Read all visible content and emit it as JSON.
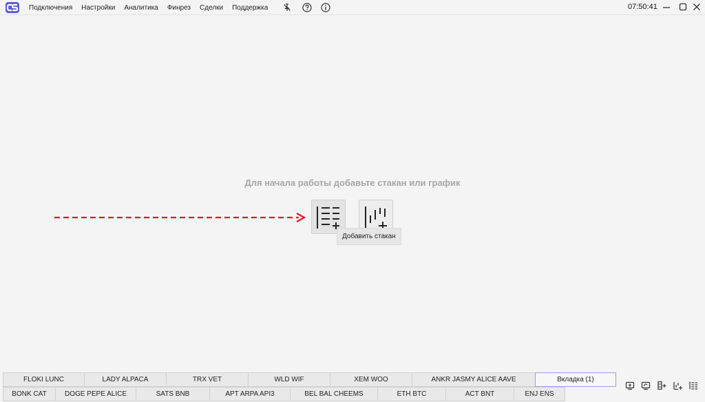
{
  "menu": {
    "items": [
      "Подключения",
      "Настройки",
      "Аналитика",
      "Финрез",
      "Сделки",
      "Поддержка"
    ]
  },
  "header": {
    "icons": [
      "pin-off-icon",
      "help-icon",
      "info-icon"
    ],
    "clock": "07:50:41"
  },
  "main": {
    "prompt": "Для начала работы добавьте стакан или график",
    "tooltip": "Добавить стакан"
  },
  "tabs": {
    "row1": [
      "FLOKI LUNC",
      "LADY ALPACA",
      "TRX VET",
      "WLD WIF",
      "XEM WOO",
      "ANKR JASMY ALICE AAVE",
      "Вкладка (1)"
    ],
    "row2": [
      "BONK CAT",
      "DOGE PEPE ALICE",
      "SATS BNB",
      "APT ARPA API3",
      "BEL BAL CHEEMS",
      "ETH BTC",
      "ACT BNT",
      "ENJ ENS"
    ],
    "active": "Вкладка (1)"
  },
  "colors": {
    "accent": "#5b5bd6",
    "arrow": "#e0141e",
    "active_tab_border": "#a59bd6"
  }
}
